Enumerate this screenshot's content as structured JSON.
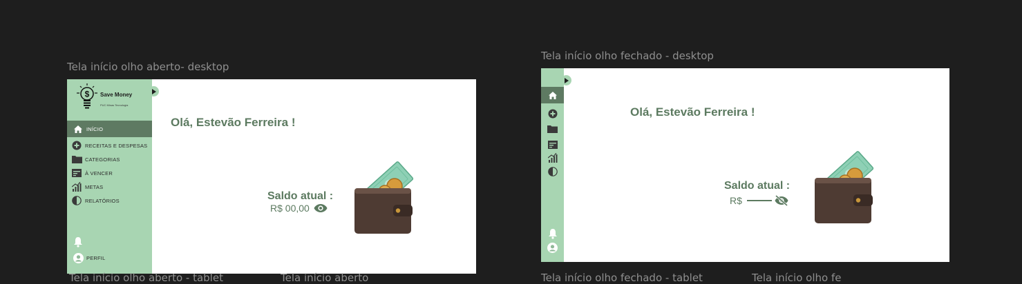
{
  "frames": {
    "open": {
      "label": "Tela início olho aberto- desktop",
      "brand": {
        "name": "Save Money",
        "subtitle": "PUC Minas Tecnologia"
      },
      "nav": [
        {
          "label": "INÍCIO",
          "icon": "home-icon",
          "active": true
        },
        {
          "label": "RECEITAS E DESPESAS",
          "icon": "plus-circle-icon"
        },
        {
          "label": "CATEGORIAS",
          "icon": "folder-icon"
        },
        {
          "label": "À VENCER",
          "icon": "bill-icon"
        },
        {
          "label": "METAS",
          "icon": "chart-icon"
        },
        {
          "label": "RELATÓRIOS",
          "icon": "contrast-icon"
        }
      ],
      "profile_label": "PERFIL",
      "greeting": "Olá, Estevão Ferreira !",
      "balance_title": "Saldo atual :",
      "balance_value": "R$ 00,00",
      "eye_icon": "eye-open-icon"
    },
    "closed": {
      "label": "Tela início olho fechado - desktop",
      "greeting": "Olá, Estevão Ferreira !",
      "balance_title": "Saldo atual :",
      "balance_currency": "R$",
      "eye_icon": "eye-closed-icon"
    }
  },
  "bottom_labels": [
    "Tela início olho aberto - tablet",
    "Tela início aberto",
    "Tela início olho fechado - tablet",
    "Tela início olho fe"
  ],
  "colors": {
    "canvas": "#1e1e1e",
    "sidebar": "#a8d5b2",
    "active": "#5e7a62",
    "text_accent": "#5c7a60"
  }
}
